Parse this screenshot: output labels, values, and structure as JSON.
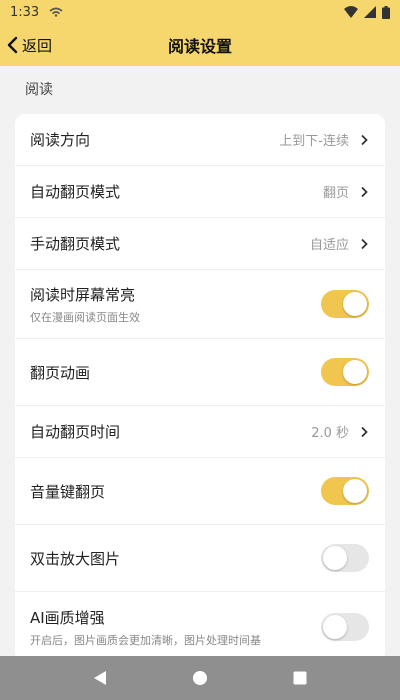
{
  "status_bar": {
    "time": "1:33"
  },
  "header": {
    "back_label": "返回",
    "title": "阅读设置"
  },
  "section": {
    "title": "阅读"
  },
  "settings": [
    {
      "label": "阅读方向",
      "value": "上到下-连续"
    },
    {
      "label": "自动翻页模式",
      "value": "翻页"
    },
    {
      "label": "手动翻页模式",
      "value": "自适应"
    },
    {
      "label": "阅读时屏幕常亮",
      "sub": "仅在漫画阅读页面生效",
      "toggle": true
    },
    {
      "label": "翻页动画",
      "toggle": true
    },
    {
      "label": "自动翻页时间",
      "value": "2.0 秒"
    },
    {
      "label": "音量键翻页",
      "toggle": true
    },
    {
      "label": "双击放大图片",
      "toggle": false
    },
    {
      "label": "AI画质增强",
      "sub": "开启后，图片画质会更加清晰，图片处理时间基",
      "toggle": false
    }
  ],
  "colors": {
    "accent": "#f5d76e",
    "toggle_on": "#f0c64e",
    "toggle_off": "#e6e6e6"
  }
}
